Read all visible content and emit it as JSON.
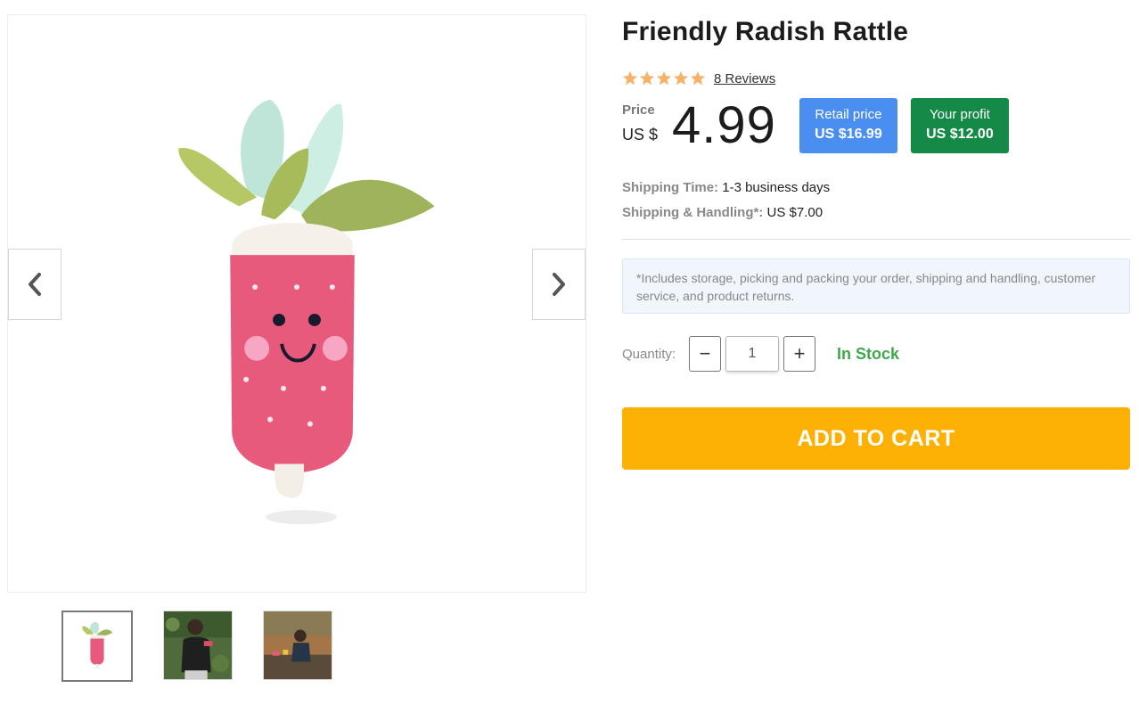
{
  "product": {
    "title": "Friendly Radish Rattle",
    "reviews_label": "8 Reviews",
    "rating": 5,
    "rating_max": 5,
    "star_color": "#f6b26b"
  },
  "price": {
    "label": "Price",
    "currency": "US $",
    "amount": "4.99"
  },
  "badges": {
    "retail_title": "Retail price",
    "retail_value": "US $16.99",
    "retail_color": "#4a8ff0",
    "profit_title": "Your profit",
    "profit_value": "US $12.00",
    "profit_color": "#158a47"
  },
  "shipping": {
    "time_label": "Shipping Time:",
    "time_value": "1-3 business days",
    "handling_label": "Shipping & Handling*:",
    "handling_value": "US $7.00"
  },
  "note": "*Includes storage, picking and packing your order, shipping and handling, customer service, and product returns.",
  "quantity": {
    "label": "Quantity:",
    "value": "1",
    "minus": "−",
    "plus": "+"
  },
  "stock_status": "In Stock",
  "cart_button": "ADD TO CART",
  "cart_color": "#fdb104",
  "gallery": {
    "prev_icon": "chevron-left-icon",
    "next_icon": "chevron-right-icon",
    "thumbnail_count": 3,
    "active_thumbnail": 1
  }
}
